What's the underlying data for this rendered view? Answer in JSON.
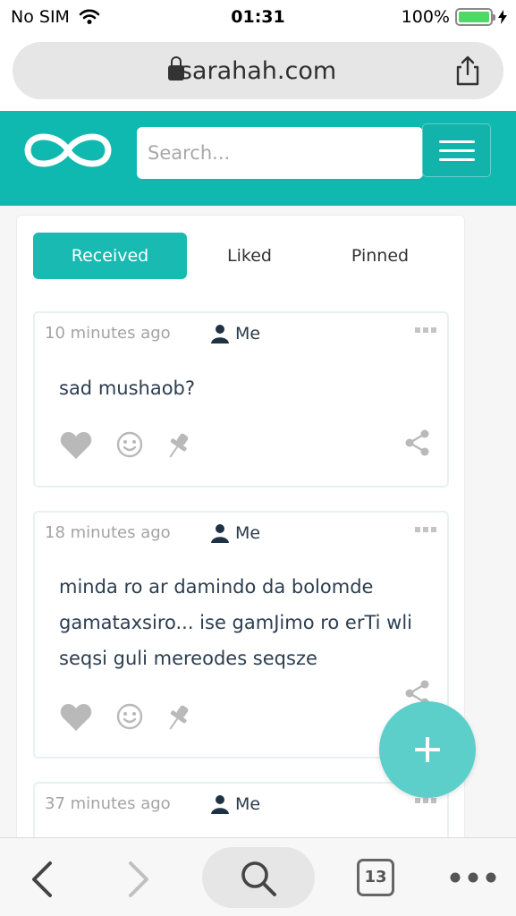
{
  "status_bar": {
    "carrier": "No SIM",
    "time": "01:31",
    "battery": "100%",
    "battery_level": 1.0,
    "icons": [
      "wifi-icon",
      "battery-icon",
      "charging-bolt-icon"
    ]
  },
  "browser": {
    "url": "sarahah.com",
    "icons": [
      "lock-icon",
      "share-icon"
    ]
  },
  "header": {
    "logo": "sarahah-logo-icon",
    "search_placeholder": "Search...",
    "menu_icon": "hamburger-menu-icon",
    "brand_color": "#10b9b0"
  },
  "tabs": [
    {
      "label": "Received",
      "active": true
    },
    {
      "label": "Liked",
      "active": false
    },
    {
      "label": "Pinned",
      "active": false
    }
  ],
  "messages": [
    {
      "time": "10 minutes ago",
      "sender": "Me",
      "text": "sad mushaob?"
    },
    {
      "time": "18 minutes ago",
      "sender": "Me",
      "lines": [
        "minda ro ar damindo da bolomde",
        "gamataxsiro... ise gamJimo ro erTi wli",
        "seqsi guli mereodes seqsze"
      ]
    },
    {
      "time": "37 minutes ago",
      "sender": "Me"
    }
  ],
  "message_actions": [
    "heart-icon",
    "smile-icon",
    "pin-icon",
    "share-icon"
  ],
  "fab": {
    "icon": "plus-icon",
    "color": "#5ccfca"
  },
  "toolbar": {
    "tab_count": "13",
    "icons": [
      "back-icon",
      "forward-icon",
      "search-icon",
      "tabs-icon",
      "more-icon"
    ]
  }
}
